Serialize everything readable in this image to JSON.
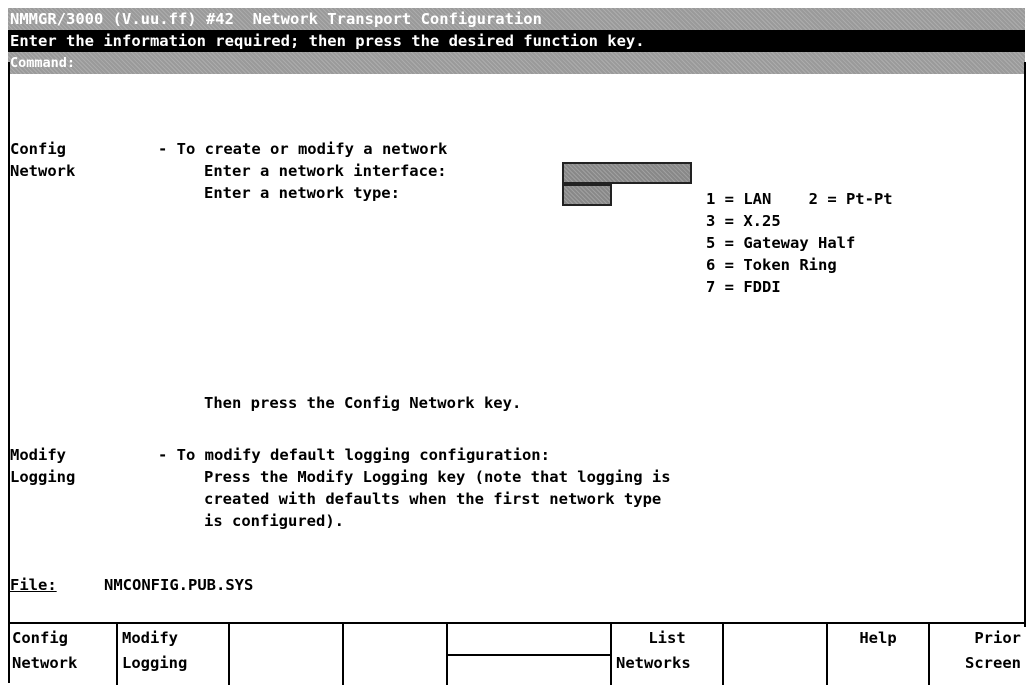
{
  "title": "NMMGR/3000 (V.uu.ff) #42  Network Transport Configuration",
  "instruction": "Enter the information required; then press the desired function key.",
  "command_label": "Command:",
  "config": {
    "label1": "Config",
    "label2": "Network",
    "dash_text": "- To create or modify a network",
    "interface_prompt": "Enter a network interface:",
    "type_prompt": "Enter a network type:",
    "then_text": "Then press the Config Network key."
  },
  "types": [
    "1 = LAN    2 = Pt-Pt",
    "3 = X.25",
    "5 = Gateway Half",
    "6 = Token Ring",
    "7 = FDDI"
  ],
  "modify": {
    "label1": "Modify",
    "label2": "Logging",
    "dash_text": "- To modify default logging configuration:",
    "line1": "Press the Modify Logging key (note that logging is",
    "line2": "created with defaults when the first network type",
    "line3": "is configured)."
  },
  "file": {
    "label": "File:",
    "value": "NMCONFIG.PUB.SYS"
  },
  "fkeys": [
    {
      "top": "Config",
      "bottom": "Network"
    },
    {
      "top": "Modify",
      "bottom": "Logging"
    },
    {
      "top": "",
      "bottom": ""
    },
    {
      "top": "",
      "bottom": ""
    },
    {
      "top": "",
      "bottom": ""
    },
    {
      "top": "List",
      "bottom": "Networks"
    },
    {
      "top": "",
      "bottom": ""
    },
    {
      "top": "Help",
      "bottom": ""
    },
    {
      "top": "Prior",
      "bottom": "Screen"
    }
  ]
}
